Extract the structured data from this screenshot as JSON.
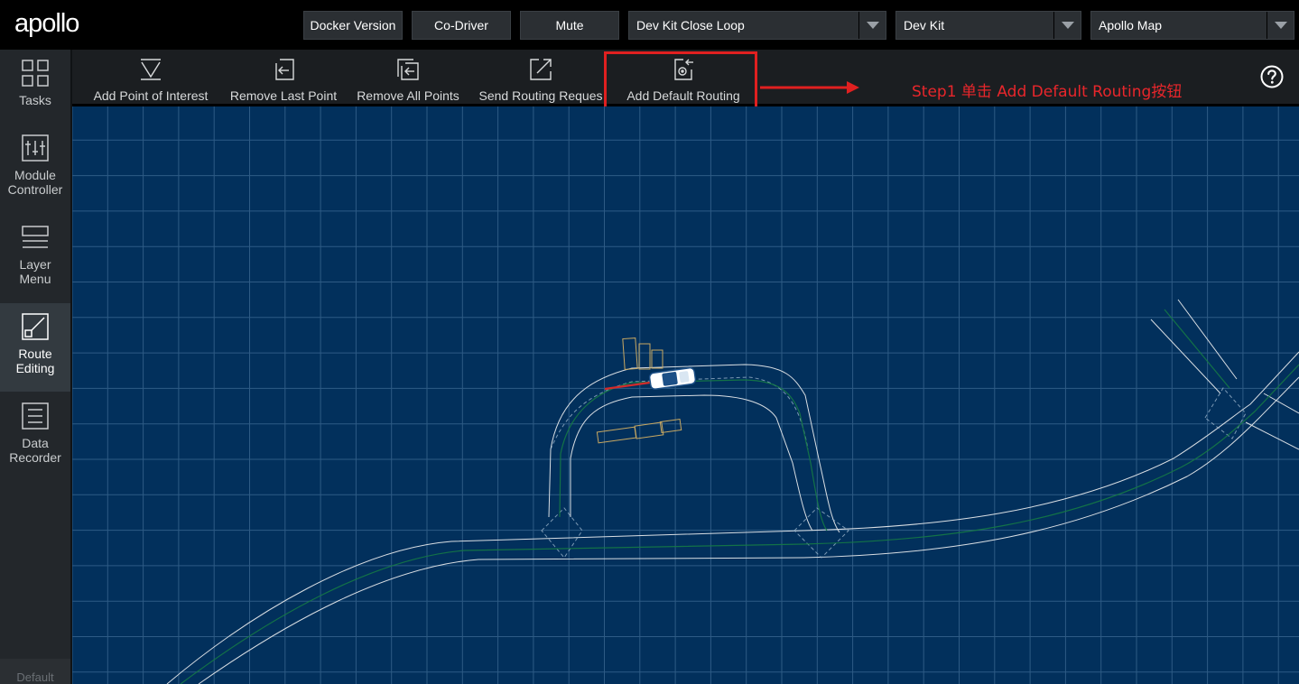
{
  "header": {
    "logo_text": "apollo",
    "buttons": [
      {
        "label": "Docker Version"
      },
      {
        "label": "Co-Driver"
      },
      {
        "label": "Mute"
      }
    ],
    "selects": [
      {
        "value": "Dev Kit Close Loop"
      },
      {
        "value": "Dev Kit"
      },
      {
        "value": "Apollo Map"
      }
    ]
  },
  "sidebar": {
    "items": [
      {
        "label": "Tasks",
        "icon": "tasks-grid-icon"
      },
      {
        "label": "Module\nController",
        "icon": "module-controller-icon"
      },
      {
        "label": "Layer\nMenu",
        "icon": "layer-menu-icon"
      },
      {
        "label": "Route\nEditing",
        "icon": "route-editing-icon",
        "active": true
      },
      {
        "label": "Data\nRecorder",
        "icon": "data-recorder-icon"
      }
    ],
    "footer": "Default"
  },
  "toolbar": {
    "tools": [
      {
        "label": "Add Point of Interest",
        "icon": "add-point-icon"
      },
      {
        "label": "Remove Last Point",
        "icon": "remove-last-point-icon"
      },
      {
        "label": "Remove All Points",
        "icon": "remove-all-points-icon"
      },
      {
        "label": "Send Routing Reques",
        "icon": "send-routing-icon"
      },
      {
        "label": "Add Default Routing",
        "icon": "add-default-routing-icon"
      }
    ],
    "help_icon": "help-icon"
  },
  "annotation": {
    "text": "Step1 单击 Add Default Routing按钮",
    "color": "#e8262b"
  },
  "colors": {
    "map_background": "#02305c",
    "grid": "#3d6a93",
    "lane": "#d9dee3",
    "route": "#0f6b3a",
    "active_sidebar": "#333a40"
  }
}
